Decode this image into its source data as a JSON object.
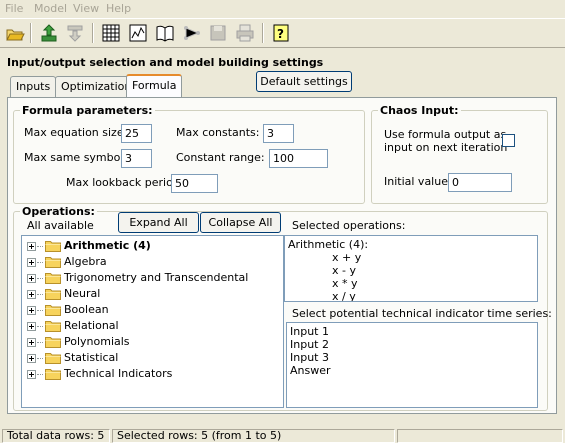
{
  "menu": [
    "File",
    "Model",
    "View",
    "Help"
  ],
  "toolbar": {
    "buttons": [
      "open-icon",
      "upload-icon",
      "download-icon",
      "grid-icon",
      "chart-icon",
      "book-icon",
      "network-icon",
      "save-icon",
      "print-icon",
      "help-icon"
    ]
  },
  "section_title": "Input/output selection and model building settings",
  "tabs": [
    "Inputs",
    "Optimization",
    "Formula"
  ],
  "active_tab": "Formula",
  "default_settings_label": "Default settings",
  "formula_params": {
    "title": "Formula parameters:",
    "max_equation_size_label": "Max equation size:",
    "max_equation_size": "25",
    "max_constants_label": "Max constants:",
    "max_constants": "3",
    "max_same_symbols_label": "Max same symbols:",
    "max_same_symbols": "3",
    "constant_range_label": "Constant range: ±",
    "constant_range": "100",
    "max_lookback_label": "Max lookback period:",
    "max_lookback": "50"
  },
  "chaos_input": {
    "title": "Chaos Input:",
    "use_output_label_1": "Use formula output as",
    "use_output_label_2": "input on next iteration",
    "use_output_checked": false,
    "initial_value_label": "Initial value:",
    "initial_value": "0"
  },
  "operations": {
    "title": "Operations:",
    "all_available_label": "All available",
    "expand_all_label": "Expand All",
    "collapse_all_label": "Collapse All",
    "tree": [
      {
        "label": "Arithmetic (4)",
        "bold": true
      },
      {
        "label": "Algebra"
      },
      {
        "label": "Trigonometry and Transcendental"
      },
      {
        "label": "Neural"
      },
      {
        "label": "Boolean"
      },
      {
        "label": "Relational"
      },
      {
        "label": "Polynomials"
      },
      {
        "label": "Statistical"
      },
      {
        "label": "Technical Indicators"
      }
    ],
    "selected_label": "Selected operations:",
    "selected_header": "Arithmetic (4):",
    "selected_items": [
      "x + y",
      "x - y",
      "x * y",
      "x / y"
    ],
    "series_label": "Select potential technical indicator time series:",
    "series_items": [
      "Input 1",
      "Input 2",
      "Input 3",
      "Answer"
    ]
  },
  "status": {
    "total_rows": "Total data rows: 5",
    "selected_rows": "Selected rows: 5  (from 1 to 5)"
  }
}
